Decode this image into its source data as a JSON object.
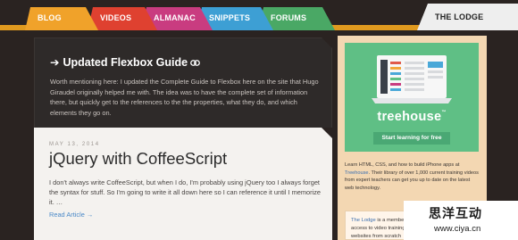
{
  "nav": {
    "tabs": [
      {
        "label": "BLOG",
        "color": "#f0a22a"
      },
      {
        "label": "VIDEOS",
        "color": "#df4130"
      },
      {
        "label": "ALMANAC",
        "color": "#c93c80"
      },
      {
        "label": "SNIPPETS",
        "color": "#3d9fd4"
      },
      {
        "label": "FORUMS",
        "color": "#4aa865"
      }
    ],
    "active_tab": {
      "label": "THE LODGE",
      "color": "#eeeeee"
    },
    "strip_color": "#e09a1f"
  },
  "featured": {
    "title": "Updated Flexbox Guide",
    "body": "Worth mentioning here: I updated the Complete Guide to Flexbox here on the site that Hugo Giraudel originally helped me with. The idea was to have the complete set of information there, but quickly get to the references to the the properties, what they do, and which elements they go on."
  },
  "post": {
    "date": "MAY 13, 2014",
    "title": "jQuery with CoffeeScript",
    "excerpt": "I don't always write CoffeeScript, but when I do, I'm probably using jQuery too I always forget the syntax for stuff. So I'm going to write it all down here so I can reference it until I memorize it. …",
    "read_more": "Read Article →"
  },
  "sidebar": {
    "ad": {
      "brand": "treehouse",
      "trademark": "™",
      "cta": "Start learning for free",
      "text_before": "Learn HTML, CSS, and how to build iPhone apps at ",
      "link": "Treehouse",
      "text_after": ". Their library of over 1,000 current training videos from expert teachers can get you up to date on the latest web technology."
    },
    "lodge": {
      "link": "The Lodge",
      "text_line1": " is a membe",
      "text_line2": "access to video training",
      "text_line3": "websites from scratch"
    }
  },
  "watermark": {
    "cn": "思洋互动",
    "url": "www.ciya.cn"
  }
}
